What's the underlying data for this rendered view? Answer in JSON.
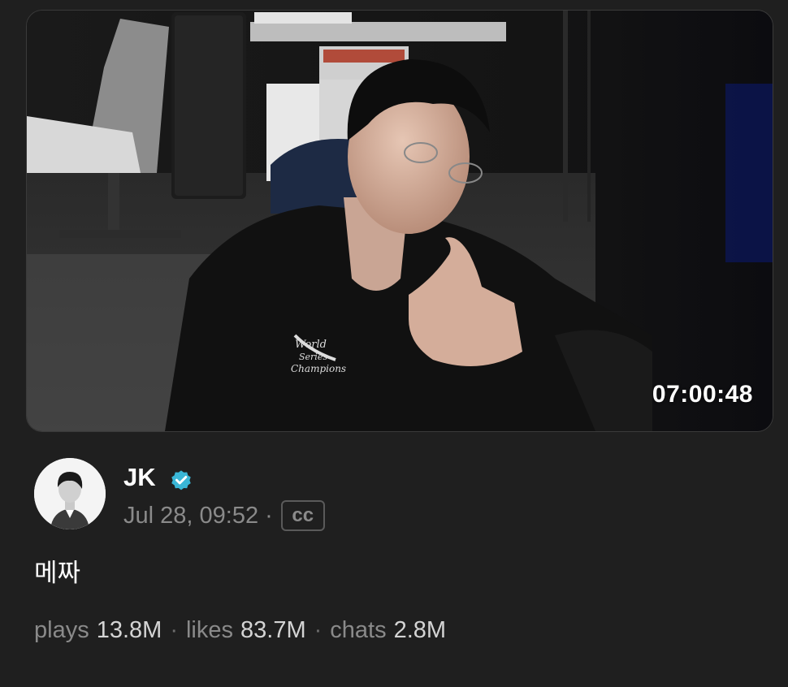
{
  "video": {
    "duration": "07:00:48",
    "thumbnail_alt": "World Series Champions"
  },
  "author": {
    "name": "JK",
    "verified_icon": "verified-badge-icon",
    "avatar_icon": "profile-avatar"
  },
  "post": {
    "date": "Jul 28, 09:52",
    "separator": "·",
    "cc_badge": "cc",
    "text": "메짜"
  },
  "stats": {
    "plays_label": "plays",
    "plays_value": "13.8M",
    "likes_label": "likes",
    "likes_value": "83.7M",
    "chats_label": "chats",
    "chats_value": "2.8M",
    "separator": "·"
  },
  "colors": {
    "background": "#1f1f1f",
    "verified": "#3ab6d6",
    "muted_text": "#8a8a8a",
    "stat_value": "#d4d4d4"
  }
}
